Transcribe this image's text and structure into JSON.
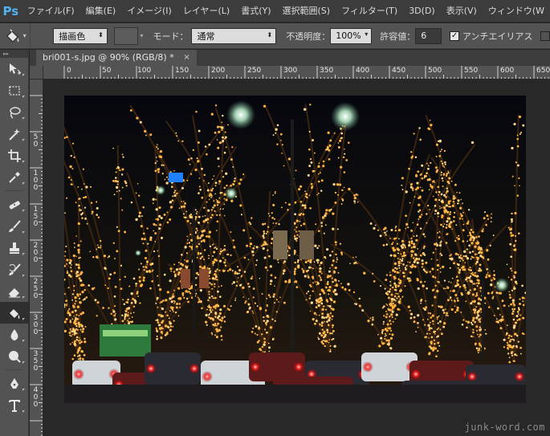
{
  "app": {
    "logo": "Ps"
  },
  "menu": [
    "ファイル(F)",
    "編集(E)",
    "イメージ(I)",
    "レイヤー(L)",
    "書式(Y)",
    "選択範囲(S)",
    "フィルター(T)",
    "3D(D)",
    "表示(V)",
    "ウィンドウ(W"
  ],
  "options": {
    "tool_icon": "paint-bucket-icon",
    "fill_source": "描画色",
    "mode_label": "モード：",
    "mode_value": "通常",
    "opacity_label": "不透明度：",
    "opacity_value": "100%",
    "tolerance_label": "許容値：",
    "tolerance_value": "6",
    "antialias_label": "アンチエイリアス",
    "antialias_checked": true
  },
  "document": {
    "tab_title": "bri001-s.jpg @ 90% (RGB/8) *",
    "close": "×"
  },
  "ruler": {
    "h_labels": [
      "0",
      "50",
      "100",
      "150",
      "200",
      "250",
      "300",
      "350",
      "400",
      "450",
      "500",
      "550",
      "600",
      "650"
    ],
    "v_labels": [
      "5\n0",
      "1\n0\n0",
      "1\n5\n0",
      "2\n0\n0",
      "2\n5\n0",
      "3\n0\n0",
      "3\n5\n0",
      "4\n0\n0"
    ]
  },
  "tools": [
    "move-icon",
    "marquee-icon",
    "lasso-icon",
    "magic-wand-icon",
    "crop-icon",
    "eyedropper-icon",
    "healing-icon",
    "brush-icon",
    "stamp-icon",
    "history-brush-icon",
    "eraser-icon",
    "paint-bucket-icon",
    "blur-icon",
    "dodge-icon",
    "pen-icon",
    "type-icon"
  ],
  "active_tool": "paint-bucket-icon",
  "watermark": "junk-word.com"
}
